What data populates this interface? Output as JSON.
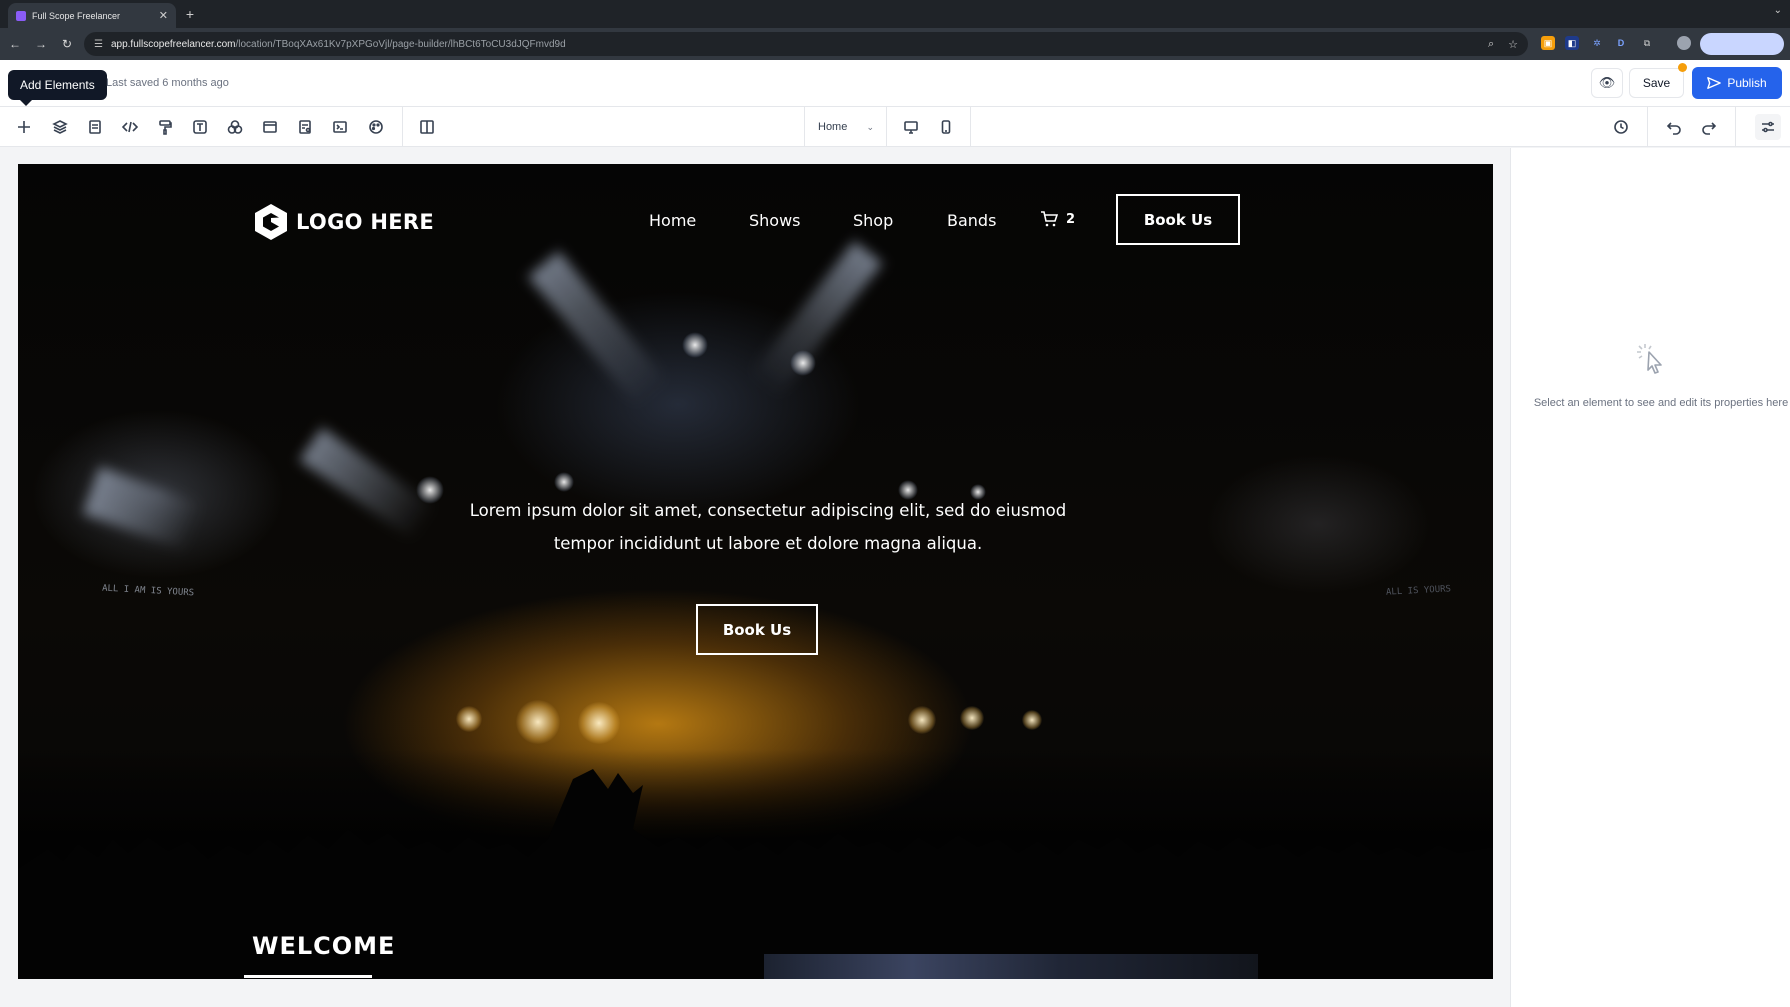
{
  "browser": {
    "tab_title": "Full Scope Freelancer",
    "url_domain": "app.fullscopefreelancer.com",
    "url_path": "/location/TBoqXAx61Kv7pXPGoVjl/page-builder/lhBCt6ToCU3dJQFmvd9d"
  },
  "builder": {
    "tooltip": "Add Elements",
    "last_saved": "Last saved 6 months ago",
    "save_label": "Save",
    "publish_label": "Publish",
    "page_selector": "Home"
  },
  "site": {
    "logo_text": "LOGO HERE",
    "nav": [
      "Home",
      "Shows",
      "Shop",
      "Bands"
    ],
    "cart_count": "2",
    "nav_cta": "Book Us",
    "hero_line1": "Lorem ipsum dolor sit amet, consectetur adipiscing elit, sed do eiusmod",
    "hero_line2": "tempor incididunt ut labore et dolore magna aliqua.",
    "hero_cta": "Book Us",
    "banner_left": "ALL I AM IS YOURS",
    "banner_right": "ALL IS YOURS",
    "welcome": "WELCOME"
  },
  "panel": {
    "hint": "Select an element to see and edit its properties here"
  },
  "colors": {
    "publish": "#2563eb",
    "canvas": "#050505",
    "accent_glow": "#d28c14"
  }
}
